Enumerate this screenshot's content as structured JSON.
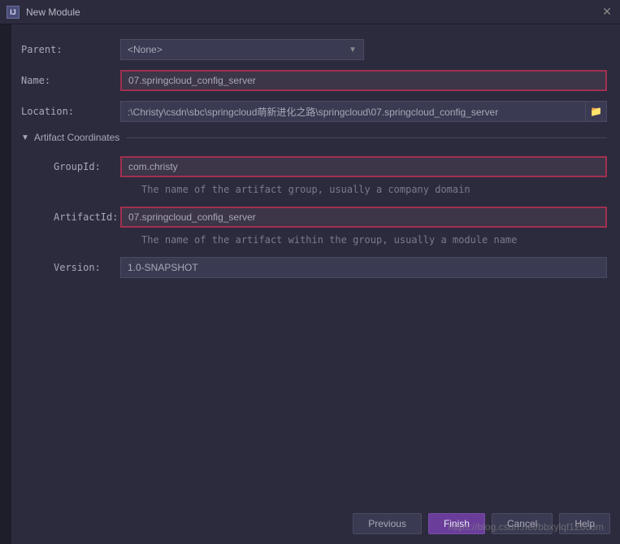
{
  "titlebar": {
    "title": "New Module"
  },
  "form": {
    "parent_label": "Parent:",
    "parent_value": "<None>",
    "name_label": "Name:",
    "name_value": "07.springcloud_config_server",
    "location_label": "Location:",
    "location_value": ":\\Christy\\csdn\\sbc\\springcloud萌新进化之路\\springcloud\\07.springcloud_config_server"
  },
  "artifact": {
    "section_title": "Artifact Coordinates",
    "groupid_label": "GroupId:",
    "groupid_value": "com.christy",
    "groupid_help": "The name of the artifact group, usually a company domain",
    "artifactid_label": "ArtifactId:",
    "artifactid_value": "07.springcloud_config_server",
    "artifactid_help": "The name of the artifact within the group, usually a module name",
    "version_label": "Version:",
    "version_value": "1.0-SNAPSHOT"
  },
  "buttons": {
    "previous": "Previous",
    "finish": "Finish",
    "cancel": "Cancel",
    "help": "Help"
  },
  "watermark": "https://blog.csdn.net/bbxylqf126com"
}
